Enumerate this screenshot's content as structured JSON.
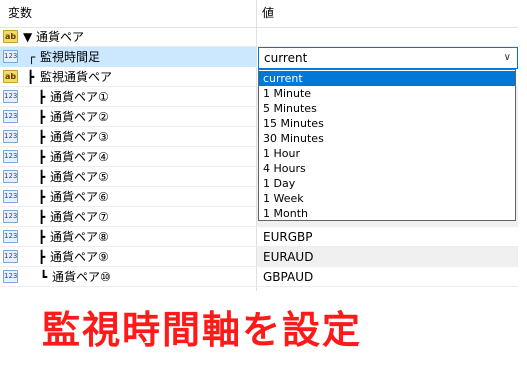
{
  "columns": {
    "variable": "変数",
    "value": "値"
  },
  "icons": {
    "text_type": "ab",
    "number_type": "123"
  },
  "rows": [
    {
      "tree": "▼",
      "label": "通貨ペア",
      "value": ""
    },
    {
      "tree": "┌",
      "label": "監視時間足",
      "value": "current"
    },
    {
      "tree": "┣",
      "label": "監視通貨ペア",
      "value": ""
    },
    {
      "tree": "┣",
      "label": "通貨ペア①",
      "value": ""
    },
    {
      "tree": "┣",
      "label": "通貨ペア②",
      "value": ""
    },
    {
      "tree": "┣",
      "label": "通貨ペア③",
      "value": ""
    },
    {
      "tree": "┣",
      "label": "通貨ペア④",
      "value": ""
    },
    {
      "tree": "┣",
      "label": "通貨ペア⑤",
      "value": ""
    },
    {
      "tree": "┣",
      "label": "通貨ペア⑥",
      "value": ""
    },
    {
      "tree": "┣",
      "label": "通貨ペア⑦",
      "value": ""
    },
    {
      "tree": "┣",
      "label": "通貨ペア⑧",
      "value": "EURGBP"
    },
    {
      "tree": "┣",
      "label": "通貨ペア⑨",
      "value": "EURAUD"
    },
    {
      "tree": "┗",
      "label": "通貨ペア⑩",
      "value": "GBPAUD"
    }
  ],
  "combo": {
    "selected": "current",
    "arrow": "∨"
  },
  "dropdown_options": [
    "current",
    "1 Minute",
    "5 Minutes",
    "15 Minutes",
    "30 Minutes",
    "1 Hour",
    "4 Hours",
    "1 Day",
    "1 Week",
    "1 Month"
  ],
  "caption": "監視時間軸を設定",
  "colors": {
    "caption": "#ff1a1a",
    "selection": "#0078d7",
    "row_highlight": "#cce8ff"
  }
}
